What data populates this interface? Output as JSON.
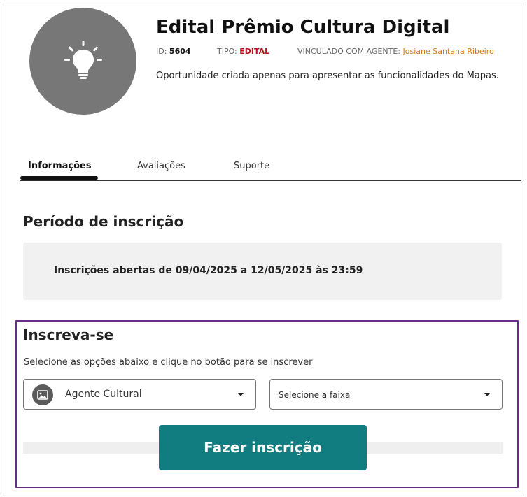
{
  "header": {
    "title": "Edital Prêmio Cultura Digital",
    "id_label": "ID:",
    "id_value": "5604",
    "tipo_label": "TIPO:",
    "tipo_value": "EDITAL",
    "agente_label": "VINCULADO COM AGENTE:",
    "agente_value": "Josiane Santana Ribeiro",
    "description": "Oportunidade criada apenas para apresentar as funcionalidades do Mapas.",
    "avatar_icon": "lightbulb-icon"
  },
  "tabs": [
    {
      "label": "Informações",
      "active": true
    },
    {
      "label": "Avaliações",
      "active": false
    },
    {
      "label": "Suporte",
      "active": false
    }
  ],
  "periodo": {
    "heading": "Período de inscrição",
    "text_prefix": "Inscrições abertas de ",
    "text_dates": "09/04/2025 a 12/05/2025 às 23:59"
  },
  "inscreva": {
    "heading": "Inscreva-se",
    "description": "Selecione as opções abaixo e clique no botão para se inscrever",
    "agent_select": {
      "value": "Agente Cultural",
      "icon": "image-icon"
    },
    "faixa_select": {
      "placeholder": "Selecione a faixa"
    },
    "submit_label": "Fazer inscrição"
  },
  "colors": {
    "accent": "#127d80",
    "tipo": "#b5121b",
    "agent_link": "#d27b14",
    "section_border": "#6a2a87"
  }
}
